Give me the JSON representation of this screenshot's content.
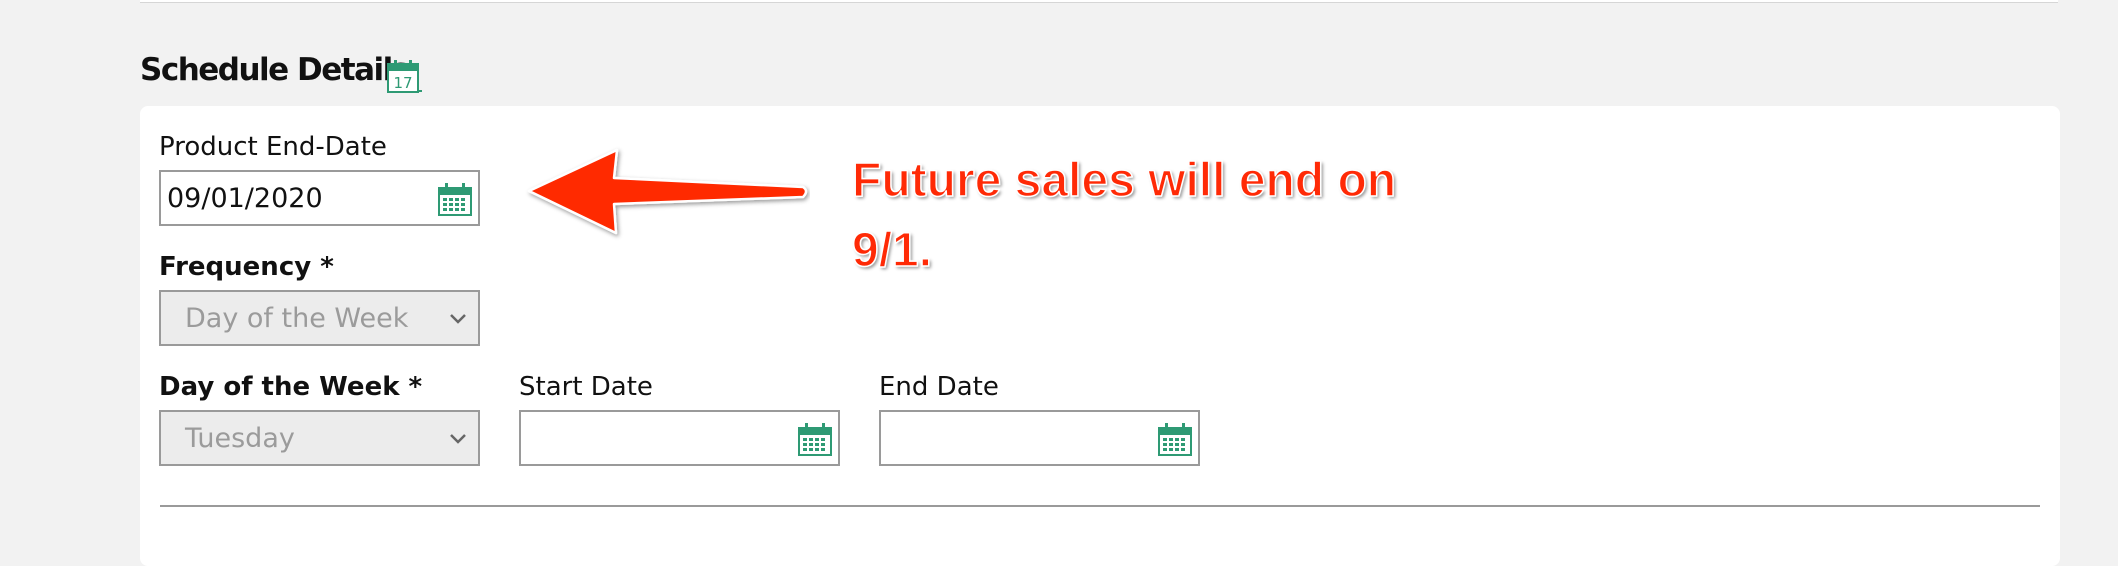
{
  "schedule": {
    "title": "Schedule Details",
    "product_end_date": {
      "label": "Product End-Date",
      "value": "09/01/2020"
    },
    "frequency": {
      "label": "Frequency *",
      "selected": "Day of the Week"
    },
    "day_of_week": {
      "label": "Day of the Week *",
      "selected": "Tuesday"
    },
    "start_date": {
      "label": "Start Date",
      "value": ""
    },
    "end_date": {
      "label": "End Date",
      "value": ""
    }
  },
  "annotation": {
    "text": "Future sales will end on 9/1.",
    "color": "#ff2a06"
  },
  "icons": {
    "title_icon": "calendar-17-icon",
    "date_picker": "calendar-icon",
    "select": "chevron-down-icon"
  },
  "colors": {
    "accent": "#2e9a74",
    "background": "#f2f2f2"
  }
}
